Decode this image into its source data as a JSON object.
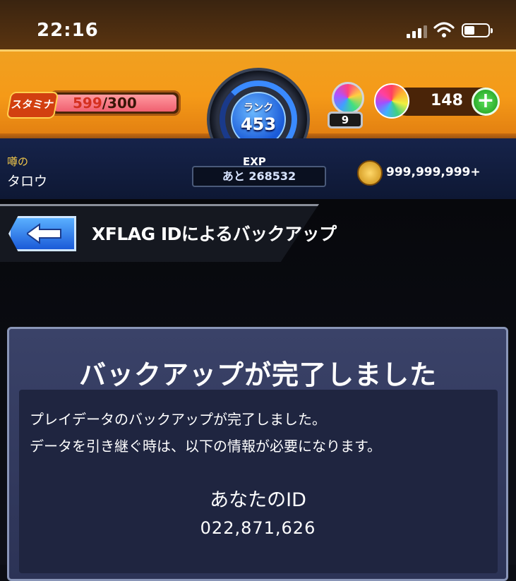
{
  "status_bar": {
    "time": "22:16",
    "signal_bars": 3,
    "battery_level": 0.4
  },
  "header": {
    "stamina_icon_label": "スタミナ",
    "stamina_current": "599",
    "stamina_max": "/300",
    "rank_label": "ランク",
    "rank_value": "453",
    "gem_count": "9",
    "orb_count": "148",
    "orb_add_label": "+"
  },
  "player": {
    "title": "噂の",
    "name": "タロウ",
    "exp_label": "EXP",
    "exp_remaining": "あと 268532",
    "coins": "999,999,999+"
  },
  "screen": {
    "title": "XFLAG IDによるバックアップ",
    "back_icon": "back-arrow-icon"
  },
  "dialog": {
    "title": "バックアップが完了しました",
    "message_line1": "プレイデータのバックアップが完了しました。",
    "message_line2": "データを引き継ぐ時は、以下の情報が必要になります。",
    "id_label": "あなたのID",
    "id_value": "022,871,626"
  }
}
